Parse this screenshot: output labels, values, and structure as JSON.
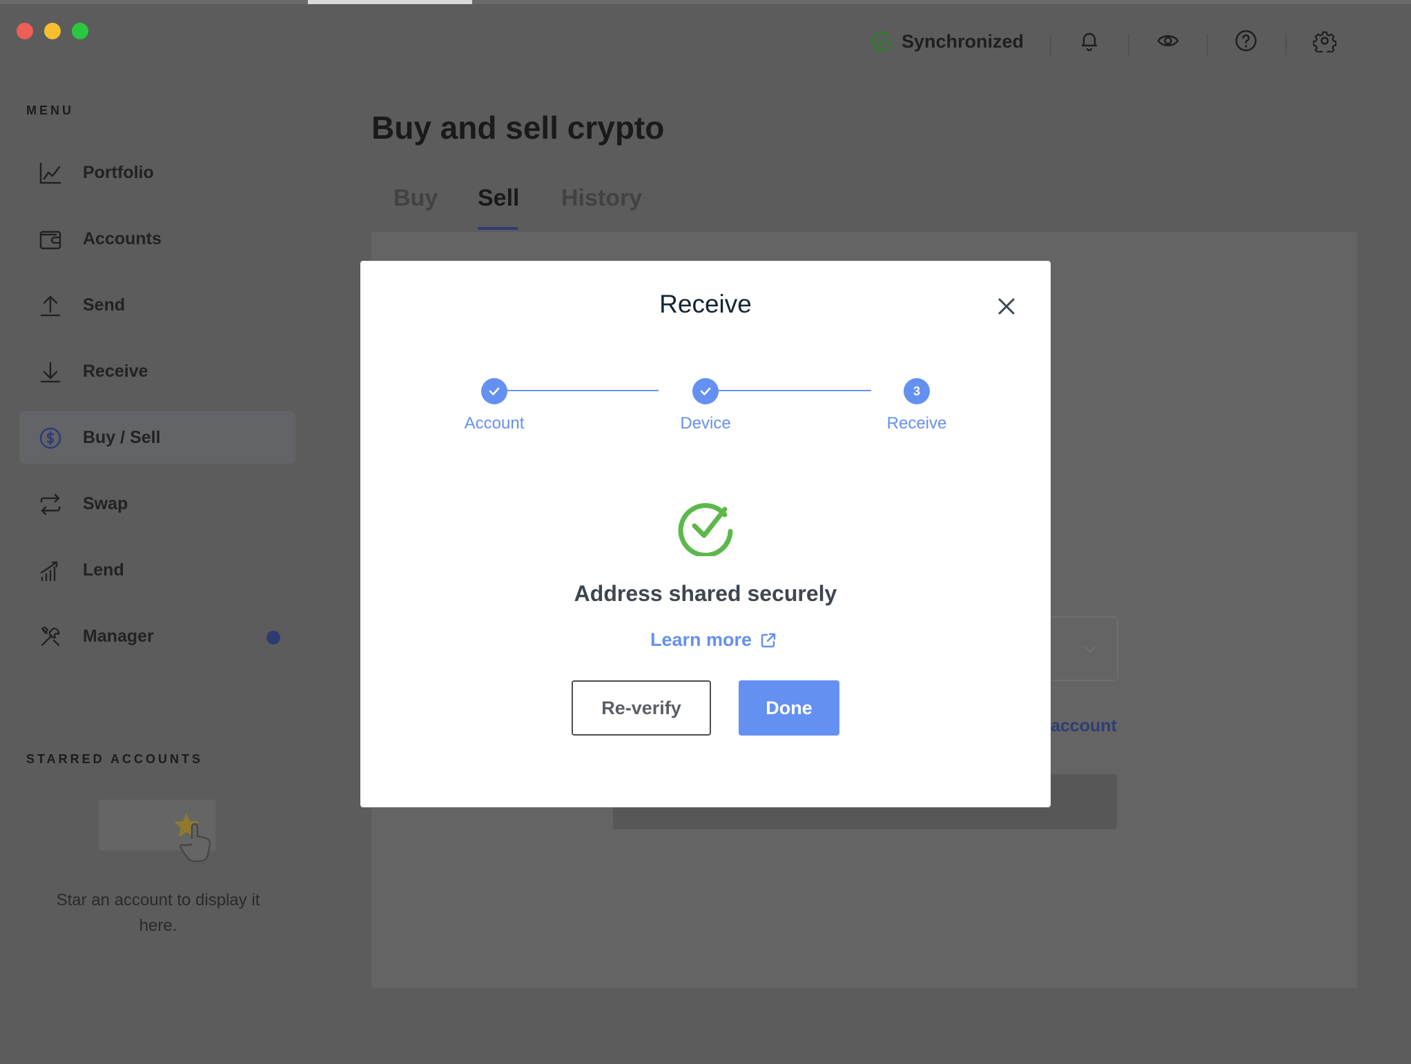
{
  "window": {
    "traffic_lights": [
      "close",
      "minimize",
      "zoom"
    ]
  },
  "topbar": {
    "sync_status": "Synchronized",
    "icons": [
      "check-circle-icon",
      "bell-icon",
      "eye-icon",
      "help-icon",
      "gear-icon"
    ]
  },
  "sidebar": {
    "menu_title": "MENU",
    "items": [
      {
        "label": "Portfolio",
        "icon": "chart-icon"
      },
      {
        "label": "Accounts",
        "icon": "wallet-icon"
      },
      {
        "label": "Send",
        "icon": "upload-icon"
      },
      {
        "label": "Receive",
        "icon": "download-icon"
      },
      {
        "label": "Buy / Sell",
        "icon": "dollar-circle-icon",
        "active": true
      },
      {
        "label": "Swap",
        "icon": "swap-icon"
      },
      {
        "label": "Lend",
        "icon": "lend-icon"
      },
      {
        "label": "Manager",
        "icon": "tools-icon",
        "has_badge": true
      }
    ],
    "starred_title": "STARRED ACCOUNTS",
    "starred_empty_text": "Star an account to display it here."
  },
  "main": {
    "title": "Buy and sell crypto",
    "tabs": [
      {
        "label": "Buy",
        "active": false
      },
      {
        "label": "Sell",
        "active": true
      },
      {
        "label": "History",
        "active": false
      }
    ],
    "background_link": "account"
  },
  "modal": {
    "title": "Receive",
    "steps": [
      {
        "label": "Account",
        "state": "done",
        "marker": ""
      },
      {
        "label": "Device",
        "state": "done",
        "marker": ""
      },
      {
        "label": "Receive",
        "state": "current",
        "marker": "3"
      }
    ],
    "success_text": "Address shared securely",
    "learn_more": "Learn more",
    "reverify_label": "Re-verify",
    "done_label": "Done"
  },
  "colors": {
    "accent": "#6490f1",
    "success": "#5cb84a",
    "overlay_bg": "#5c5c5c",
    "modal_bg": "#ffffff"
  }
}
